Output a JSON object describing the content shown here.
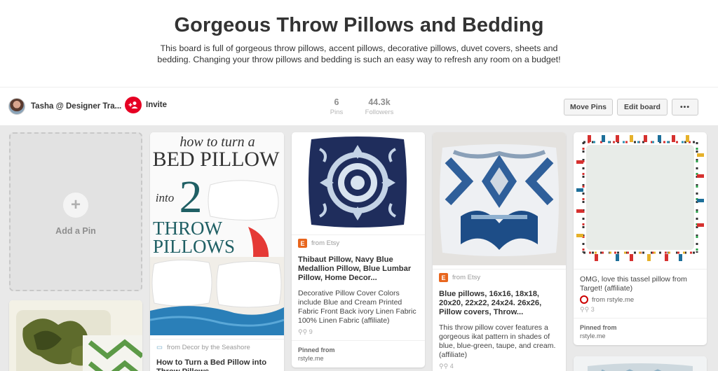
{
  "board": {
    "title": "Gorgeous Throw Pillows and Bedding",
    "description": "This board is full of gorgeous throw pillows, accent pillows, decorative pillows, duvet covers, sheets and bedding. Changing your throw pillows and bedding is such an easy way to refresh any room on a budget!"
  },
  "owner": {
    "name": "Tasha @ Designer Tra..."
  },
  "invite": {
    "label": "Invite",
    "icon": "add-person-icon"
  },
  "stats": {
    "pins_count": "6",
    "pins_label": "Pins",
    "followers_count": "44.3k",
    "followers_label": "Followers"
  },
  "actions": {
    "move_pins": "Move Pins",
    "edit_board": "Edit board",
    "more": "•••"
  },
  "add_pin": {
    "icon": "+",
    "label": "Add a Pin"
  },
  "pins": [
    {
      "image_text": {
        "line1": "how to turn a",
        "line2": "BED PILLOW",
        "line3": "into",
        "line4": "2",
        "line5": "THROW",
        "line6": "PILLOWS"
      },
      "source": "from Decor by the Seashore",
      "title": "How to Turn a Bed Pillow into Throw Pillows"
    },
    {
      "source": "from Etsy",
      "title": "Thibaut Pillow, Navy Blue Medallion Pillow, Blue Lumbar Pillow, Home Decor...",
      "description": "Decorative Pillow Cover Colors include Blue and Cream Printed Fabric Front Back ivory Linen Fabric 100% Linen Fabric (affiliate)",
      "repins": "9",
      "pinned_from_label": "Pinned from",
      "pinned_from_site": "rstyle.me"
    },
    {
      "source": "from Etsy",
      "title": "Blue pillows, 16x16, 18x18, 20x20, 22x22, 24x24. 26x26, Pillow covers, Throw...",
      "description": "This throw pillow cover features a gorgeous ikat pattern in shades of blue, blue-green, taupe, and cream. (affiliate)",
      "repins": "4"
    },
    {
      "description": "OMG, love this tassel pillow from Target! (affiliate)",
      "source": "from rstyle.me",
      "repins": "3",
      "pinned_from_label": "Pinned from",
      "pinned_from_site": "rstyle.me"
    }
  ],
  "colors": {
    "accent_red": "#e60023",
    "etsy_orange": "#e8661e",
    "navy": "#1f2d5c",
    "teal": "#1f5f64"
  }
}
